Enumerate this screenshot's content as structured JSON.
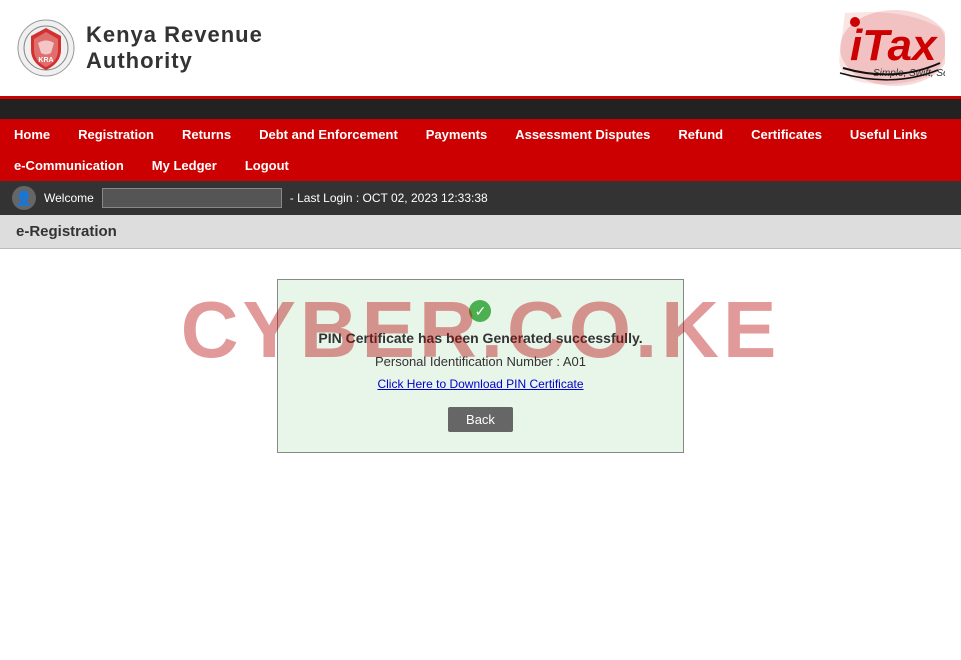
{
  "header": {
    "kra_line1": "Kenya Revenue",
    "kra_line2": "Authority",
    "itax_brand": "iTax",
    "itax_tagline": "Simple, Swift, Secure"
  },
  "navbar": {
    "items_row1": [
      {
        "label": "Home",
        "id": "home"
      },
      {
        "label": "Registration",
        "id": "registration"
      },
      {
        "label": "Returns",
        "id": "returns"
      },
      {
        "label": "Debt and Enforcement",
        "id": "debt"
      },
      {
        "label": "Payments",
        "id": "payments"
      },
      {
        "label": "Assessment Disputes",
        "id": "assessment"
      },
      {
        "label": "Refund",
        "id": "refund"
      },
      {
        "label": "Certificates",
        "id": "certificates"
      },
      {
        "label": "Useful Links",
        "id": "useful-links"
      }
    ],
    "items_row2": [
      {
        "label": "e-Communication",
        "id": "e-comm"
      },
      {
        "label": "My Ledger",
        "id": "my-ledger"
      },
      {
        "label": "Logout",
        "id": "logout"
      }
    ]
  },
  "welcome_bar": {
    "welcome_label": "Welcome",
    "last_login": "- Last Login : OCT 02, 2023 12:33:38"
  },
  "page": {
    "heading": "e-Registration"
  },
  "success": {
    "title": "PIN Certificate has been Generated successfully.",
    "pin_label": "Personal Identification Number : A01",
    "download_link": "Click Here to Download PIN Certificate",
    "back_button": "Back"
  },
  "watermark": {
    "text": "CYBER.CO.KE"
  }
}
